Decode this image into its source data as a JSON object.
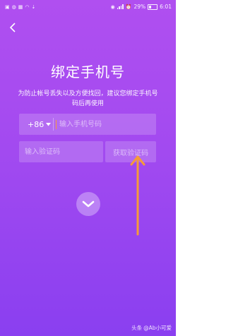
{
  "status_bar": {
    "left_icons": [
      "sim-icon",
      "wechat-icon",
      "gallery-icon",
      "wifi-icon",
      "download-icon"
    ],
    "right_icons": [
      "eye-icon",
      "signal-icon",
      "alarm-icon"
    ],
    "battery": "29%",
    "time": "6:01"
  },
  "header": {
    "back_icon": "chevron-left-icon"
  },
  "page": {
    "title": "绑定手机号",
    "instruction": "为防止帐号丢失以及方便找回，建议您绑定手机号码后再使用"
  },
  "phone": {
    "country_code": "+86",
    "placeholder": "输入手机号码"
  },
  "verification": {
    "placeholder": "输入验证码",
    "get_code_label": "获取验证码"
  },
  "submit": {
    "icon": "check-icon"
  },
  "watermark": {
    "label": "头条",
    "handle": "@Ab小可爱"
  },
  "colors": {
    "background_top": "#b04ff0",
    "background_bottom": "#8a3ff0",
    "arrow": "#f59a3a"
  }
}
